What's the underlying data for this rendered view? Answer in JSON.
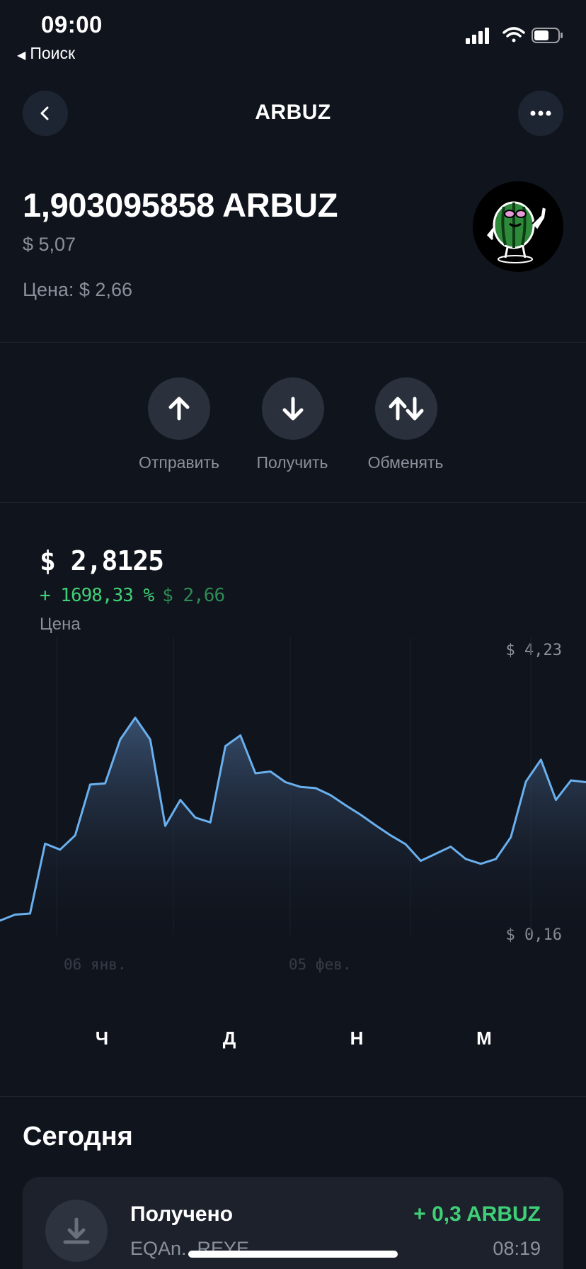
{
  "status_bar": {
    "time": "09:00",
    "back_app": "Поиск"
  },
  "header": {
    "title": "ARBUZ"
  },
  "balance": {
    "amount": "1,903095858 ARBUZ",
    "usd": "$ 5,07",
    "price": "Цена: $ 2,66"
  },
  "actions": [
    {
      "label": "Отправить",
      "icon": "arrow-up-icon"
    },
    {
      "label": "Получить",
      "icon": "arrow-down-icon"
    },
    {
      "label": "Обменять",
      "icon": "swap-icon"
    }
  ],
  "chart": {
    "current_price": "$ 2,8125",
    "change_percent": "+ 1698,33 %",
    "change_value": "$ 2,66",
    "caption": "Цена",
    "axis_max": "$ 4,23",
    "axis_min": "$ 0,16",
    "date_labels": [
      "06 янв.",
      "05 фев."
    ]
  },
  "chart_data": {
    "type": "area",
    "title": "",
    "xlabel": "",
    "ylabel": "",
    "x_ticks": [
      "06 янв.",
      "05 фев."
    ],
    "ylim": [
      0.16,
      4.23
    ],
    "values": [
      0.16,
      0.26,
      0.28,
      1.46,
      1.36,
      1.6,
      2.46,
      2.48,
      3.22,
      3.59,
      3.22,
      1.76,
      2.2,
      1.9,
      1.82,
      3.11,
      3.29,
      2.65,
      2.68,
      2.5,
      2.42,
      2.4,
      2.28,
      2.11,
      1.95,
      1.77,
      1.6,
      1.45,
      1.17,
      1.29,
      1.41,
      1.2,
      1.12,
      1.2,
      1.57,
      2.51,
      2.88,
      2.2,
      2.53,
      2.5
    ],
    "color": "#6ab0ee",
    "grid": false
  },
  "ranges": [
    "Ч",
    "Д",
    "Н",
    "М"
  ],
  "today": {
    "title": "Сегодня",
    "transactions": [
      {
        "type": "Получено",
        "address": "EQAn...REYE",
        "amount": "+ 0,3 ARBUZ",
        "time": "08:19"
      }
    ]
  },
  "colors": {
    "background": "#10141d",
    "accent_green": "#3fcf76",
    "chart_line": "#6ab0ee"
  }
}
